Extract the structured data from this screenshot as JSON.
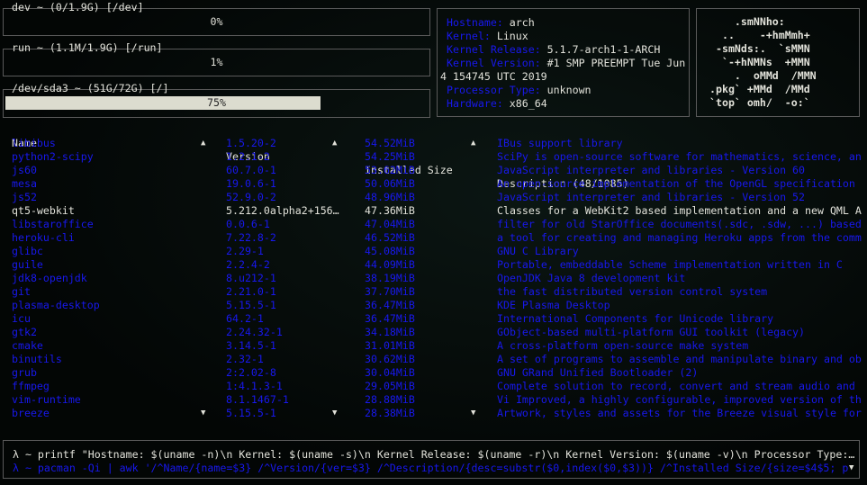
{
  "disks": [
    {
      "title": "dev ~ (0/1.9G) [/dev]",
      "percent_label": "0%",
      "percent": 0
    },
    {
      "title": "run ~ (1.1M/1.9G) [/run]",
      "percent_label": "1%",
      "percent": 1
    },
    {
      "title": "/dev/sda3 ~ (51G/72G) [/]",
      "percent_label": "75%",
      "percent": 75
    }
  ],
  "sysinfo": {
    "hostname_label": "Hostname:",
    "hostname": "arch",
    "kernel_label": "Kernel:",
    "kernel": "Linux",
    "release_label": "Kernel Release:",
    "release": "5.1.7-arch1-1-ARCH",
    "version_label": "Kernel Version:",
    "version": "#1 SMP PREEMPT Tue Jun",
    "version_cont": "4 154745 UTC 2019",
    "processor_label": "Processor Type:",
    "processor": "unknown",
    "hardware_label": "Hardware:",
    "hardware": "x86_64"
  },
  "logo": "    .smNNho:\n  ..    -+hmMmh+\n -smNds:.  `sMMN\n  `-+hNMNs  +MMN\n    .  oMMd  /MMN\n.pkg` +MMd  /MMd\n`top` omh/  -o:`",
  "table": {
    "headers": {
      "name": "Name",
      "version": "Version",
      "size": "Installed Size",
      "description": "Description (48/1085)"
    },
    "selected_index": 5,
    "rows": [
      {
        "name": "libibus",
        "version": "1.5.20-2",
        "size": "54.52MiB",
        "description": "IBus support library"
      },
      {
        "name": "python2-scipy",
        "version": "1.2.1-2",
        "size": "54.25MiB",
        "description": "SciPy is open-source software for mathematics, science, an"
      },
      {
        "name": "js60",
        "version": "60.7.0-1",
        "size": "53.62MiB",
        "description": "JavaScript interpreter and libraries - Version 60"
      },
      {
        "name": "mesa",
        "version": "19.0.6-1",
        "size": "50.06MiB",
        "description": "An open-source implementation of the OpenGL specification"
      },
      {
        "name": "js52",
        "version": "52.9.0-2",
        "size": "48.96MiB",
        "description": "JavaScript interpreter and libraries - Version 52"
      },
      {
        "name": "qt5-webkit",
        "version": "5.212.0alpha2+156…",
        "size": "47.36MiB",
        "description": "Classes for a WebKit2 based implementation and a new QML A"
      },
      {
        "name": "libstaroffice",
        "version": "0.0.6-1",
        "size": "47.04MiB",
        "description": "filter for old StarOffice documents(.sdc, .sdw, ...) based"
      },
      {
        "name": "heroku-cli",
        "version": "7.22.8-2",
        "size": "46.52MiB",
        "description": "a tool for creating and managing Heroku apps from the comm"
      },
      {
        "name": "glibc",
        "version": "2.29-1",
        "size": "45.08MiB",
        "description": "GNU C Library"
      },
      {
        "name": "guile",
        "version": "2.2.4-2",
        "size": "44.09MiB",
        "description": "Portable, embeddable Scheme implementation written in C"
      },
      {
        "name": "jdk8-openjdk",
        "version": "8.u212-1",
        "size": "38.19MiB",
        "description": "OpenJDK Java 8 development kit"
      },
      {
        "name": "git",
        "version": "2.21.0-1",
        "size": "37.70MiB",
        "description": "the fast distributed version control system"
      },
      {
        "name": "plasma-desktop",
        "version": "5.15.5-1",
        "size": "36.47MiB",
        "description": "KDE Plasma Desktop"
      },
      {
        "name": "icu",
        "version": "64.2-1",
        "size": "36.47MiB",
        "description": "International Components for Unicode library"
      },
      {
        "name": "gtk2",
        "version": "2.24.32-1",
        "size": "34.18MiB",
        "description": "GObject-based multi-platform GUI toolkit (legacy)"
      },
      {
        "name": "cmake",
        "version": "3.14.5-1",
        "size": "31.01MiB",
        "description": "A cross-platform open-source make system"
      },
      {
        "name": "binutils",
        "version": "2.32-1",
        "size": "30.62MiB",
        "description": "A set of programs to assemble and manipulate binary and ob"
      },
      {
        "name": "grub",
        "version": "2:2.02-8",
        "size": "30.04MiB",
        "description": "GNU GRand Unified Bootloader (2)"
      },
      {
        "name": "ffmpeg",
        "version": "1:4.1.3-1",
        "size": "29.05MiB",
        "description": "Complete solution to record, convert and stream audio and"
      },
      {
        "name": "vim-runtime",
        "version": "8.1.1467-1",
        "size": "28.88MiB",
        "description": "Vi Improved, a highly configurable, improved version of th"
      },
      {
        "name": "breeze",
        "version": "5.15.5-1",
        "size": "28.38MiB",
        "description": "Artwork, styles and assets for the Breeze visual style for"
      }
    ]
  },
  "commands": [
    "λ ~ printf \"Hostname: $(uname -n)\\n Kernel: $(uname -s)\\n Kernel Release: $(uname -r)\\n Kernel Version: $(uname -v)\\n Processor Type:…",
    "λ ~ pacman -Qi | awk '/^Name/{name=$3} /^Version/{ver=$3} /^Description/{desc=substr($0,index($0,$3))} /^Installed Size/{size=$4$5; p"
  ],
  "colors": {
    "accent": "#1818ee",
    "text": "#e2e2da",
    "bar": "#dcdccf"
  }
}
